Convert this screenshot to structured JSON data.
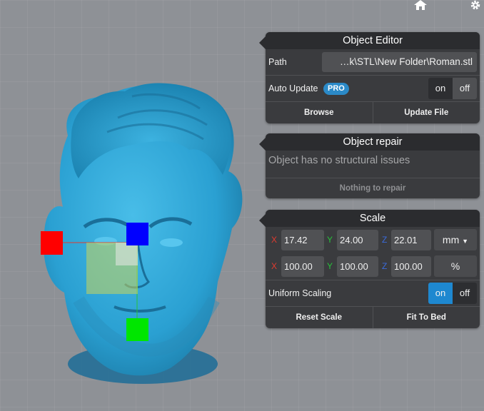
{
  "toolbar": {
    "home_icon": "home-icon",
    "settings_icon": "gear-icon"
  },
  "object_editor": {
    "title": "Object Editor",
    "path_label": "Path",
    "path_value": "…k\\STL\\New Folder\\Roman.stl",
    "auto_update_label": "Auto Update",
    "pro_badge": "PRO",
    "toggle_on": "on",
    "toggle_off": "off",
    "browse_label": "Browse",
    "update_file_label": "Update File"
  },
  "object_repair": {
    "title": "Object repair",
    "status": "Object has no structural issues",
    "button_label": "Nothing to repair"
  },
  "scale": {
    "title": "Scale",
    "size": {
      "x_label": "X",
      "x": "17.42",
      "y_label": "Y",
      "y": "24.00",
      "z_label": "Z",
      "z": "22.01",
      "unit": "mm"
    },
    "percent": {
      "x_label": "X",
      "x": "100.00",
      "y_label": "Y",
      "y": "100.00",
      "z_label": "Z",
      "z": "100.00",
      "unit": "%"
    },
    "uniform_label": "Uniform Scaling",
    "toggle_on": "on",
    "toggle_off": "off",
    "reset_label": "Reset Scale",
    "fit_label": "Fit To Bed"
  },
  "colors": {
    "axis_x": "#e03a2f",
    "axis_y": "#27c23a",
    "axis_z": "#3a6bdc",
    "handle_x": "#ff0000",
    "handle_y": "#00e600",
    "handle_z": "#0000ff",
    "model": "#2fa3d4",
    "accent": "#1e88d0"
  }
}
